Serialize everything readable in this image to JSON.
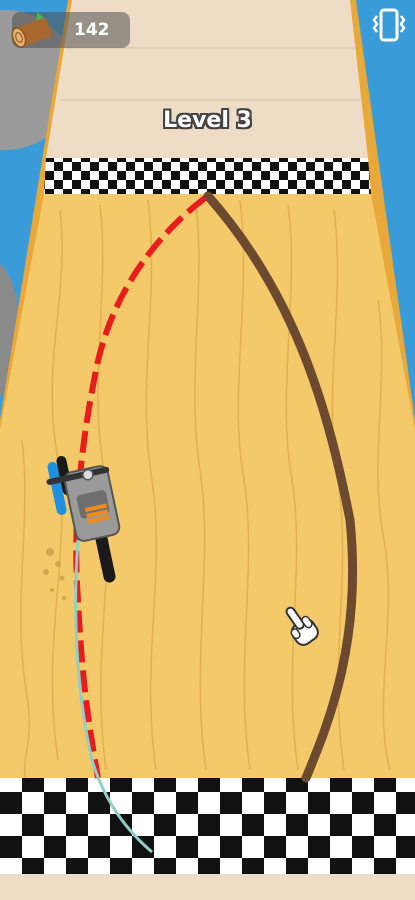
{
  "hud": {
    "log_count": "142",
    "log_icon": "wood-log-icon",
    "vibration_icon": "vibration-icon"
  },
  "level": {
    "label": "Level 3"
  },
  "scene": {
    "board_color": "#f4c969",
    "rail_color": "#e8a83a",
    "water_color": "#3a9bd9",
    "cut_line_color": "#e81c1c",
    "target_line_color": "#6b4a2f",
    "trail_color": "#8fcfc6",
    "hint_icon": "pointing-hand-icon",
    "vehicle_icon": "chainsaw-motorbike-icon"
  }
}
